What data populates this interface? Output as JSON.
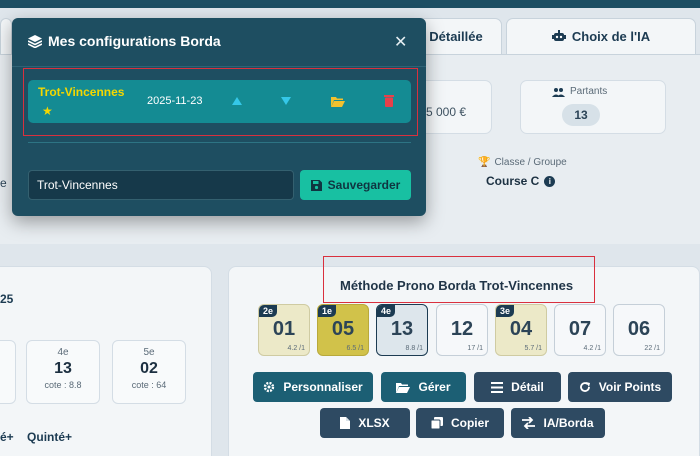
{
  "tabs": {
    "detail_label": "Détaillée",
    "ia_label": "Choix de l'IA"
  },
  "race_info": {
    "amount": "5 000 €",
    "partants_label": "Partants",
    "partants_value": "13",
    "classe_label": "Classe / Groupe",
    "classe_value": "Course C",
    "left_fragment": "e"
  },
  "modal": {
    "title": "Mes configurations Borda",
    "close": "✕",
    "configs": [
      {
        "name": "Trot-Vincennes",
        "date": "2025-11-23",
        "favorite": true
      }
    ],
    "name_input_value": "Trot-Vincennes",
    "save_label": "Sauvegarder"
  },
  "left_panel": {
    "fragment": "25",
    "places": [
      {
        "ordinal": "4e",
        "number": "13",
        "cote": "cote : 8.8"
      },
      {
        "ordinal": "5e",
        "number": "02",
        "cote": "cote : 64"
      }
    ],
    "bets": [
      "é+",
      "Quinté+"
    ]
  },
  "prono": {
    "title": "Méthode Prono Borda Trot-Vincennes",
    "picks": [
      {
        "number": "01",
        "rank": "2e",
        "cote": "4.2 /1",
        "style": "beige"
      },
      {
        "number": "05",
        "rank": "1e",
        "cote": "6.5 /1",
        "style": "gold"
      },
      {
        "number": "13",
        "rank": "4e",
        "cote": "8.8 /1",
        "style": "blue"
      },
      {
        "number": "12",
        "rank": "",
        "cote": "17 /1",
        "style": ""
      },
      {
        "number": "04",
        "rank": "3e",
        "cote": "5.7 /1",
        "style": "beige"
      },
      {
        "number": "07",
        "rank": "",
        "cote": "4.2 /1",
        "style": ""
      },
      {
        "number": "06",
        "rank": "",
        "cote": "22 /1",
        "style": ""
      }
    ],
    "buttons": {
      "personnaliser": "Personnaliser",
      "gerer": "Gérer",
      "detail": "Détail",
      "voir_points": "Voir Points",
      "xlsx": "XLSX",
      "copier": "Copier",
      "ia_borda": "IA/Borda"
    }
  },
  "colors": {
    "modal_bg": "#1e4e61",
    "row_bg": "#148b93",
    "accent_yellow": "#f5d700",
    "save_green": "#18c0a2",
    "highlight_red": "#d9303e",
    "button_teal": "#1c5f74",
    "button_dark": "#2e4a62"
  },
  "icons": {
    "modal": "layers-icon",
    "star": "star-icon",
    "up": "arrow-up-icon",
    "down": "arrow-down-icon",
    "folder": "folder-open-icon",
    "trash": "trash-icon",
    "save": "floppy-icon",
    "gear": "gear-icon",
    "list": "list-icon",
    "refresh": "refresh-icon",
    "file": "file-icon",
    "copy": "copy-icon",
    "swap": "swap-icon",
    "robot": "robot-icon",
    "users": "users-icon",
    "trophy": "trophy-icon",
    "info": "info-icon"
  }
}
